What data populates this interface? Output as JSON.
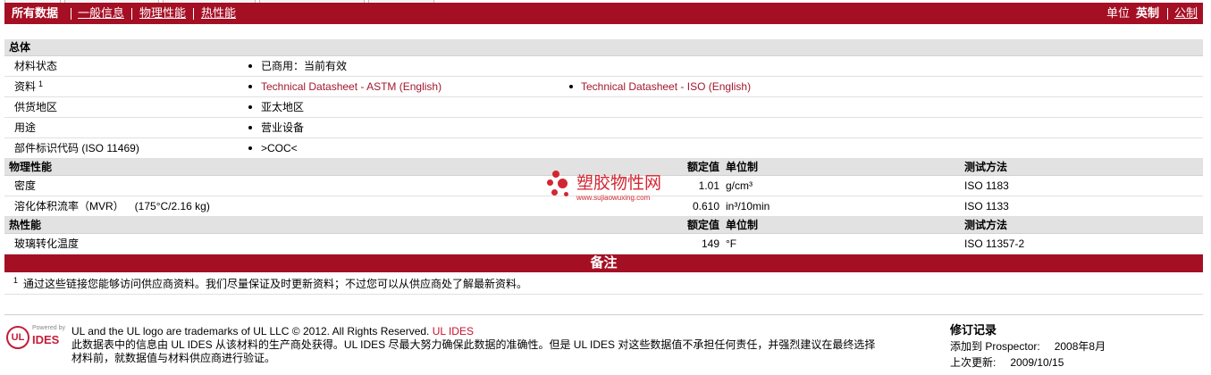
{
  "nav": {
    "all_data": "所有数据",
    "general_info": "一般信息",
    "physical": "物理性能",
    "thermal": "热性能",
    "units_label": "单位",
    "imperial": "英制",
    "metric": "公制"
  },
  "general": {
    "title": "总体",
    "rows": [
      {
        "label": "材料状态",
        "values": [
          "已商用：当前有效"
        ]
      },
      {
        "label": "资料",
        "footnote_mark": "1",
        "links": [
          "Technical Datasheet - ASTM (English)",
          "Technical Datasheet - ISO (English)"
        ]
      },
      {
        "label": "供货地区",
        "values": [
          "亚太地区"
        ]
      },
      {
        "label": "用途",
        "values": [
          "营业设备"
        ]
      },
      {
        "label": "部件标识代码 (ISO 11469)",
        "values": [
          ">COC<"
        ]
      }
    ]
  },
  "physical": {
    "title": "物理性能",
    "col_value": "额定值",
    "col_unit": "单位制",
    "col_method": "测试方法",
    "rows": [
      {
        "label": "密度",
        "value": "1.01",
        "unit": "g/cm³",
        "method": "ISO 1183"
      },
      {
        "label": "溶化体积流率（MVR）",
        "condition": "(175°C/2.16 kg)",
        "value": "0.610",
        "unit": "in³/10min",
        "method": "ISO 1133"
      }
    ]
  },
  "thermal": {
    "title": "热性能",
    "col_value": "额定值",
    "col_unit": "单位制",
    "col_method": "测试方法",
    "rows": [
      {
        "label": "玻璃转化温度",
        "value": "149",
        "unit": "°F",
        "method": "ISO 11357-2"
      }
    ]
  },
  "notes": {
    "title": "备注",
    "footnote_mark": "1",
    "footnote_text": "通过这些链接您能够访问供应商资料。我们尽量保证及时更新资料；不过您可以从供应商处了解最新资料。"
  },
  "watermark": {
    "name": "塑胶物性网",
    "url": "www.sujiaowuxing.com"
  },
  "footer": {
    "logo": {
      "mark": "UL",
      "powered_by": "Powered by",
      "brand": "IDES"
    },
    "trademark": "UL and the UL logo are trademarks of UL LLC © 2012. All Rights Reserved.",
    "trademark_link": "UL IDES",
    "disclaimer_line1": "此数据表中的信息由 UL IDES 从该材料的生产商处获得。UL IDES 尽最大努力确保此数据的准确性。但是 UL IDES 对这些数据值不承担任何责任，并强烈建议在最终选择",
    "disclaimer_line2": "材料前，就数据值与材料供应商进行验证。",
    "revision": {
      "title": "修订记录",
      "added_label": "添加到 Prospector:",
      "added_value": "2008年8月",
      "updated_label": "上次更新:",
      "updated_value": "2009/10/15"
    }
  },
  "colors": {
    "brand_red": "#a50f24",
    "link_red": "#a3172d",
    "section_header_gray": "#e2e2e2",
    "watermark_red": "#d22632"
  }
}
